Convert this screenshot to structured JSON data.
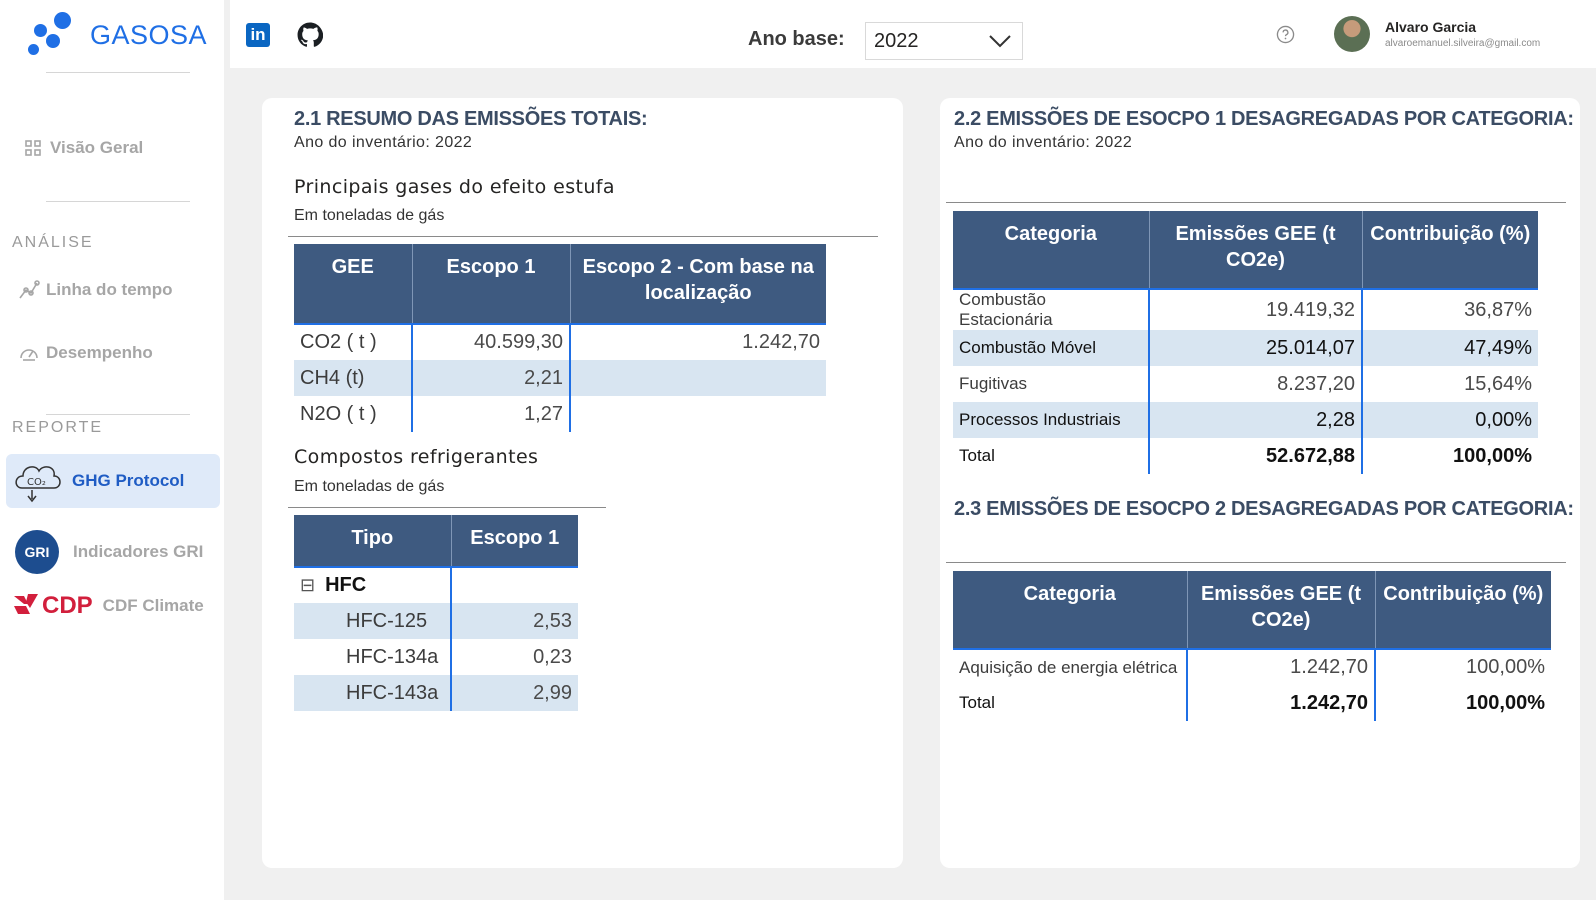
{
  "app": {
    "name": "GASOSA"
  },
  "sidebar": {
    "overview": "Visão Geral",
    "analysis_label": "ANÁLISE",
    "analysis_items": [
      "Linha do tempo",
      "Desempenho"
    ],
    "report_label": "REPORTE",
    "report_items": [
      {
        "label": "GHG Protocol",
        "icon": "co2-cloud-icon",
        "active": true
      },
      {
        "label": "Indicadores GRI",
        "icon": "gri-logo"
      },
      {
        "label": "CDF Climate",
        "icon": "cdp-logo"
      }
    ],
    "gri_text": "GRI",
    "cdp_text": "CDP",
    "co2_text": "CO₂"
  },
  "topbar": {
    "ano_label": "Ano base:",
    "ano_value": "2022",
    "user_name": "Alvaro Garcia",
    "user_email": "alvaroemanuel.silveira@gmail.com",
    "linkedin_text": "in"
  },
  "card1": {
    "title": "2.1 RESUMO DAS EMISSÕES TOTAIS:",
    "subtitle": "Ano do inventário: 2022",
    "gases": {
      "title": "Principais gases do efeito estufa",
      "unit": "Em toneladas de gás",
      "headers": [
        "GEE",
        "Escopo 1",
        "Escopo 2 - Com base na localização"
      ],
      "rows": [
        [
          "CO2 ( t )",
          "40.599,30",
          "1.242,70"
        ],
        [
          "CH4 (t)",
          "2,21",
          ""
        ],
        [
          "N2O ( t )",
          "1,27",
          ""
        ]
      ]
    },
    "refrig": {
      "title": "Compostos refrigerantes",
      "unit": "Em toneladas de gás",
      "headers": [
        "Tipo",
        "Escopo 1"
      ],
      "group": "HFC",
      "collapse_symbol": "⊟",
      "rows": [
        [
          "HFC-125",
          "2,53"
        ],
        [
          "HFC-134a",
          "0,23"
        ],
        [
          "HFC-143a",
          "2,99"
        ]
      ]
    }
  },
  "card2": {
    "title": "2.2 EMISSÕES DE ESOCPO 1 DESAGREGADAS POR CATEGORIA:",
    "subtitle": "Ano do inventário: 2022",
    "headers": [
      "Categoria",
      "Emissões GEE (t CO2e)",
      "Contribuição (%)"
    ],
    "rows": [
      [
        "Combustão Estacionária",
        "19.419,32",
        "36,87%"
      ],
      [
        "Combustão Móvel",
        "25.014,07",
        "47,49%"
      ],
      [
        "Fugitivas",
        "8.237,20",
        "15,64%"
      ],
      [
        "Processos Industriais",
        "2,28",
        "0,00%"
      ]
    ],
    "total": [
      "Total",
      "52.672,88",
      "100,00%"
    ],
    "title2": "2.3 EMISSÕES DE ESOCPO 2 DESAGREGADAS POR CATEGORIA:",
    "headers2": [
      "Categoria",
      "Emissões GEE (t CO2e)",
      "Contribuição (%)"
    ],
    "rows2": [
      [
        "Aquisição de energia elétrica",
        "1.242,70",
        "100,00%"
      ]
    ],
    "total2": [
      "Total",
      "1.242,70",
      "100,00%"
    ]
  }
}
